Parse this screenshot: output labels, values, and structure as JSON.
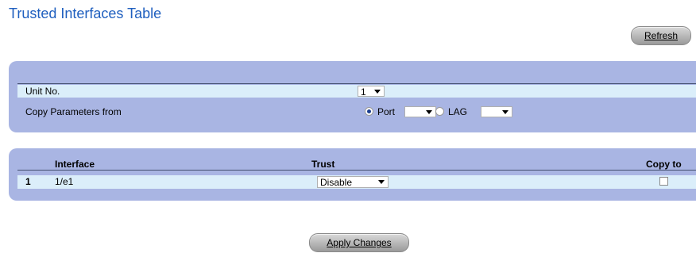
{
  "page": {
    "title": "Trusted Interfaces Table"
  },
  "buttons": {
    "refresh": "Refresh",
    "apply": "Apply Changes"
  },
  "form": {
    "unit_label": "Unit No.",
    "unit_value": "1",
    "copy_label": "Copy Parameters from",
    "port_label": "Port",
    "port_value": "",
    "lag_label": "LAG",
    "lag_value": "",
    "selected_source": "Port"
  },
  "table": {
    "headers": {
      "interface": "Interface",
      "trust": "Trust",
      "copy_to": "Copy to"
    },
    "rows": [
      {
        "index": "1",
        "interface": "1/e1",
        "trust": "Disable",
        "copy_to": false
      }
    ]
  }
}
